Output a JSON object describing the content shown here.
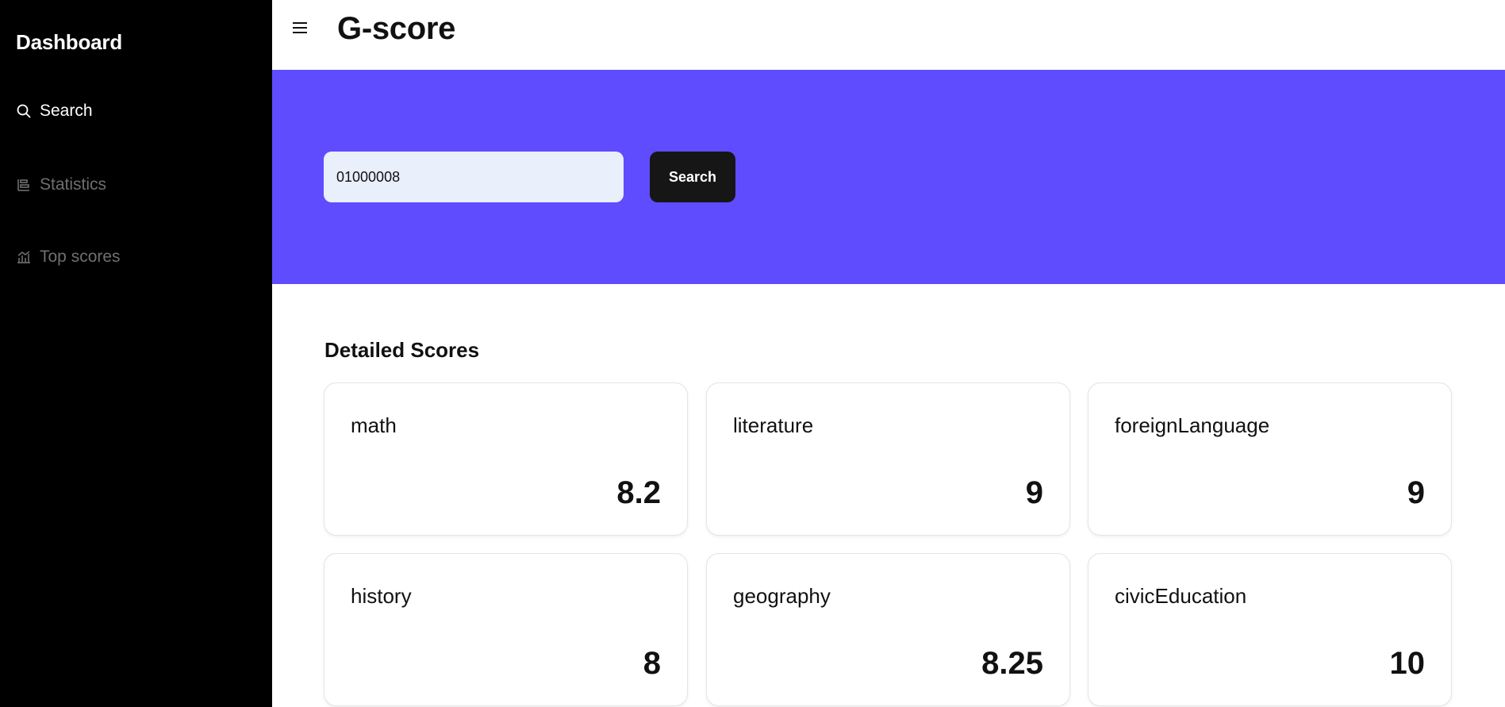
{
  "sidebar": {
    "brand": "Dashboard",
    "items": [
      {
        "label": "Search",
        "icon": "search-icon",
        "active": true
      },
      {
        "label": "Statistics",
        "icon": "statistics-icon",
        "active": false
      },
      {
        "label": "Top scores",
        "icon": "bar-chart-icon",
        "active": false
      }
    ]
  },
  "header": {
    "menu_icon": "hamburger-menu-icon",
    "title": "G-score"
  },
  "search": {
    "value": "01000008",
    "button_label": "Search"
  },
  "scores": {
    "title": "Detailed Scores",
    "items": [
      {
        "subject": "math",
        "score": "8.2"
      },
      {
        "subject": "literature",
        "score": "9"
      },
      {
        "subject": "foreignLanguage",
        "score": "9"
      },
      {
        "subject": "history",
        "score": "8"
      },
      {
        "subject": "geography",
        "score": "8.25"
      },
      {
        "subject": "civicEducation",
        "score": "10"
      }
    ]
  },
  "colors": {
    "sidebar_bg": "#000000",
    "banner_bg": "#604cff",
    "input_bg": "#e9effb",
    "button_bg": "#161616"
  }
}
